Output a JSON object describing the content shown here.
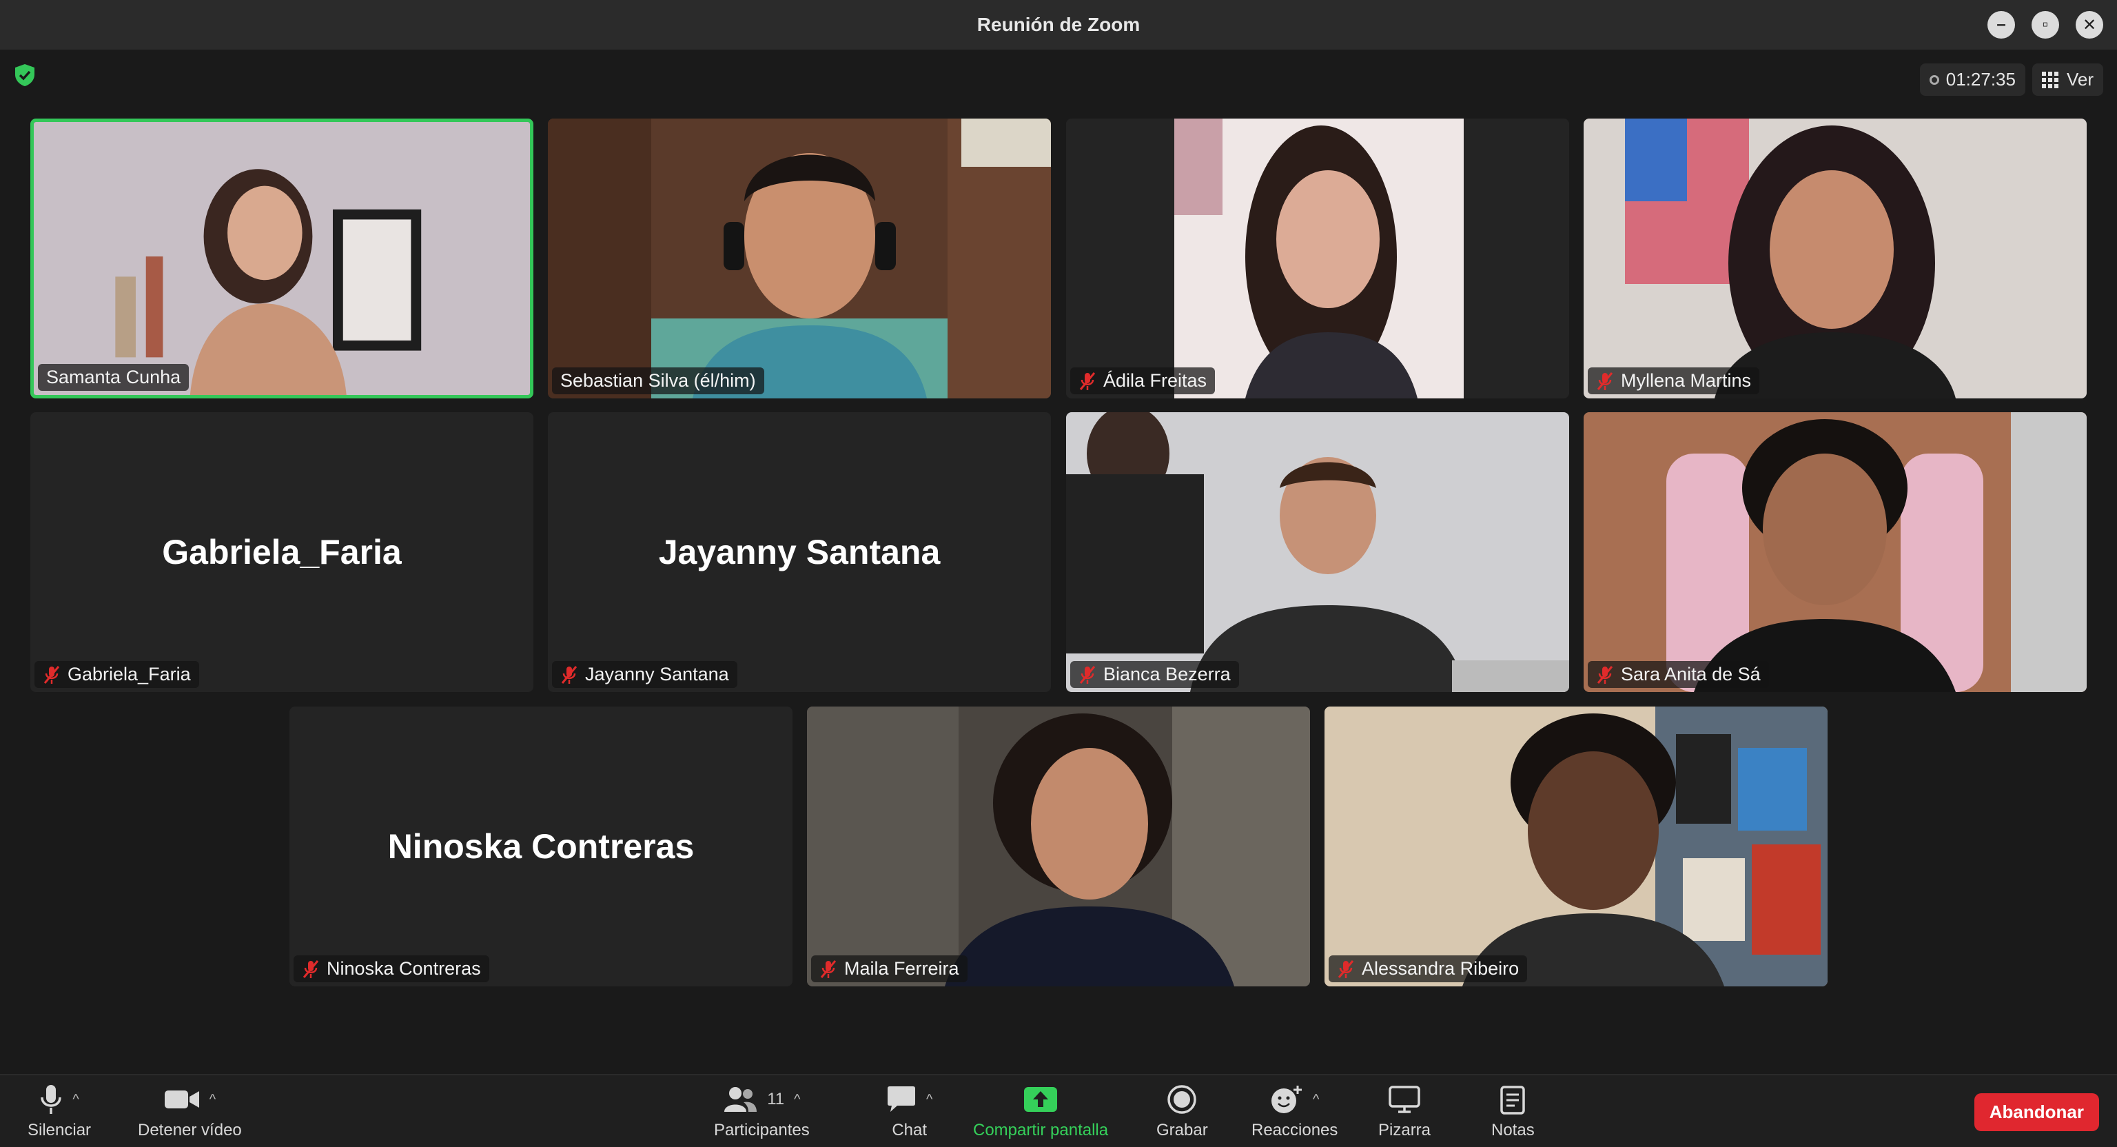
{
  "window": {
    "title": "Reunión de Zoom",
    "controls": [
      "minimize-icon",
      "maximize-icon",
      "close-icon"
    ]
  },
  "meeting": {
    "timer": "01:27:35",
    "view_label": "Ver",
    "security_color": "#34c759"
  },
  "participants": [
    {
      "name": "Samanta Cunha",
      "muted": false,
      "video": true,
      "active_speaker": true
    },
    {
      "name": "Sebastian Silva (él/him)",
      "muted": false,
      "video": true
    },
    {
      "name": "Ádila Freitas",
      "muted": true,
      "video": true
    },
    {
      "name": "Myllena Martins",
      "muted": true,
      "video": true
    },
    {
      "name": "Gabriela_Faria",
      "muted": true,
      "video": false
    },
    {
      "name": "Jayanny Santana",
      "muted": true,
      "video": false
    },
    {
      "name": "Bianca Bezerra",
      "muted": true,
      "video": true
    },
    {
      "name": "Sara Anita de Sá",
      "muted": true,
      "video": true
    },
    {
      "name": "Ninoska Contreras",
      "muted": true,
      "video": false
    },
    {
      "name": "Maila Ferreira",
      "muted": true,
      "video": true
    },
    {
      "name": "Alessandra Ribeiro",
      "muted": true,
      "video": true
    }
  ],
  "toolbar": {
    "mute_label": "Silenciar",
    "video_label": "Detener vídeo",
    "participants_label": "Participantes",
    "participants_count": "11",
    "chat_label": "Chat",
    "share_label": "Compartir pantalla",
    "record_label": "Grabar",
    "reactions_label": "Reacciones",
    "whiteboard_label": "Pizarra",
    "notes_label": "Notas",
    "leave_label": "Abandonar"
  },
  "colors": {
    "accent_green": "#35d05a",
    "leave_red": "#e0272f",
    "mute_red": "#e02b2b"
  }
}
